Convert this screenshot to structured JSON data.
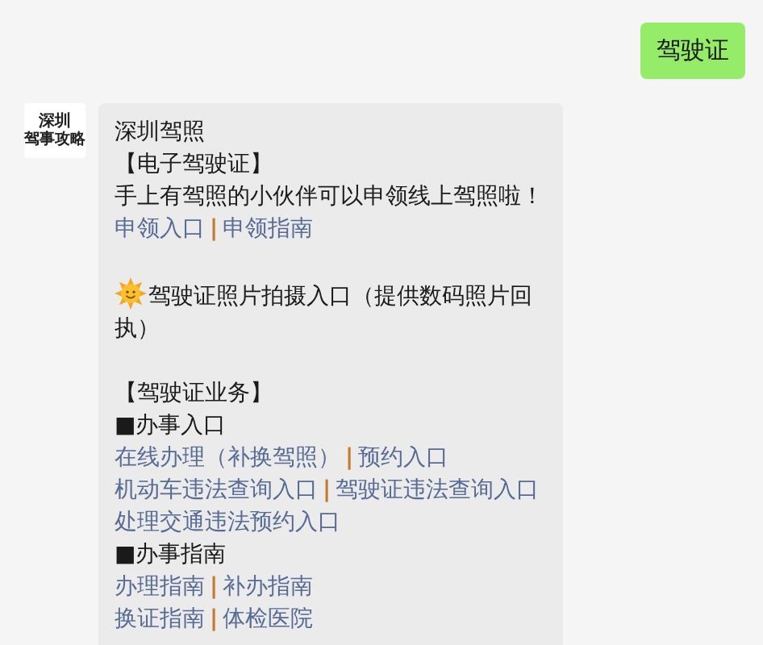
{
  "messages": [
    {
      "kind": "sent",
      "text": "驾驶证"
    },
    {
      "kind": "received",
      "avatar": {
        "line_1": "深圳",
        "line_2": "驾事攻略"
      },
      "lines": [
        {
          "kind": "text",
          "text": "深圳驾照"
        },
        {
          "kind": "text",
          "text": "【电子驾驶证】"
        },
        {
          "kind": "text",
          "text": "手上有驾照的小伙伴可以申领线上驾照啦！"
        },
        {
          "kind": "links",
          "items": [
            {
              "kind": "link",
              "text": "申领入口"
            },
            {
              "kind": "separator",
              "text": "|"
            },
            {
              "kind": "link",
              "text": "申领指南"
            }
          ]
        },
        {
          "kind": "gap"
        },
        {
          "kind": "sun_text",
          "text": "驾驶证照片拍摄入口（提供数码照片回执）"
        },
        {
          "kind": "gap"
        },
        {
          "kind": "text",
          "text": "【驾驶证业务】"
        },
        {
          "kind": "text",
          "text": "■办事入口"
        },
        {
          "kind": "links",
          "items": [
            {
              "kind": "link",
              "text": "在线办理（补换驾照）"
            },
            {
              "kind": "separator",
              "text": "|"
            },
            {
              "kind": "link",
              "text": "预约入口"
            }
          ]
        },
        {
          "kind": "links",
          "items": [
            {
              "kind": "link",
              "text": "机动车违法查询入口"
            },
            {
              "kind": "separator",
              "text": "|"
            },
            {
              "kind": "link",
              "text": "驾驶证违法查询入口"
            }
          ]
        },
        {
          "kind": "links",
          "items": [
            {
              "kind": "link",
              "text": "处理交通违法预约入口"
            }
          ]
        },
        {
          "kind": "text",
          "text": "■办事指南"
        },
        {
          "kind": "links",
          "items": [
            {
              "kind": "link",
              "text": "办理指南"
            },
            {
              "kind": "separator",
              "text": "|"
            },
            {
              "kind": "link",
              "text": "补办指南"
            }
          ]
        },
        {
          "kind": "links",
          "items": [
            {
              "kind": "link",
              "text": "换证指南"
            },
            {
              "kind": "separator",
              "text": "|"
            },
            {
              "kind": "link",
              "text": "体检医院"
            }
          ]
        }
      ]
    }
  ]
}
